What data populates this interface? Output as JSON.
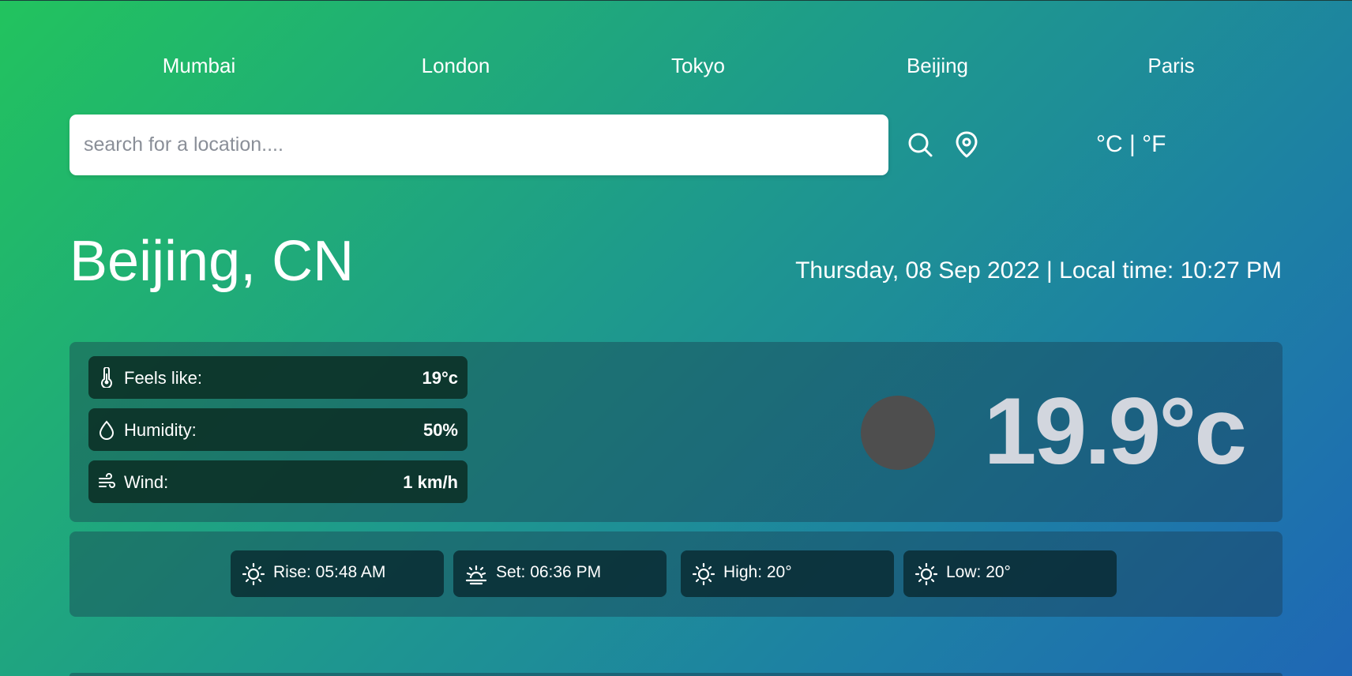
{
  "nav": {
    "cities": [
      "Mumbai",
      "London",
      "Tokyo",
      "Beijing",
      "Paris"
    ]
  },
  "search": {
    "placeholder": "search for a location....",
    "value": ""
  },
  "units": {
    "celsius": "°C",
    "separator": "|",
    "fahrenheit": "°F"
  },
  "location": {
    "name": "Beijing, CN",
    "datetime": "Thursday, 08 Sep 2022 | Local time: 10:27 PM"
  },
  "details": [
    {
      "icon": "thermometer-icon",
      "label": "Feels like:",
      "value": "19°c"
    },
    {
      "icon": "droplet-icon",
      "label": "Humidity:",
      "value": "50%"
    },
    {
      "icon": "wind-icon",
      "label": "Wind:",
      "value": "1 km/h"
    }
  ],
  "current": {
    "temperature": "19.9°c",
    "icon": "weather-icon"
  },
  "sun": [
    {
      "icon": "sun-icon",
      "text": "Rise: 05:48 AM"
    },
    {
      "icon": "sunset-icon",
      "text": "Set: 06:36 PM"
    },
    {
      "icon": "sun-icon",
      "text": "High: 20°"
    },
    {
      "icon": "sun-icon",
      "text": "Low: 20°"
    }
  ],
  "colors": {
    "gradient_start": "#22c35e",
    "gradient_end": "#1f67b5",
    "temperature_text": "#d2d6de",
    "weather_icon_placeholder": "#4e4e4e"
  }
}
